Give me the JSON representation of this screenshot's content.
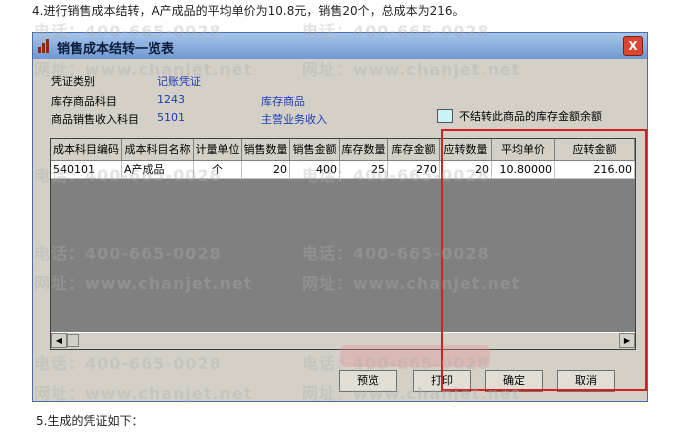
{
  "intro_text": "4.进行销售成本结转，A产成品的平均单价为10.8元，销售20个，总成本为216。",
  "outro_text": "5.生成的凭证如下：",
  "window": {
    "title": "销售成本结转一览表",
    "close_label": "X"
  },
  "fields": {
    "voucher_type_label": "凭证类别",
    "voucher_type_value": "记账凭证",
    "inventory_account_label": "库存商品科目",
    "inventory_account_code": "1243",
    "inventory_account_name": "库存商品",
    "revenue_account_label": "商品销售收入科目",
    "revenue_account_code": "5101",
    "revenue_account_name": "主营业务收入",
    "checkbox_label": "不结转此商品的库存金额余额",
    "checkbox_checked": false
  },
  "table": {
    "columns": [
      "成本科目编码",
      "成本科目名称",
      "计量单位",
      "销售数量",
      "销售金额",
      "库存数量",
      "库存金额",
      "应转数量",
      "平均单价",
      "应转金额"
    ],
    "rows": [
      [
        "540101",
        "A产成品",
        "个",
        "20",
        "400",
        "25",
        "270",
        "20",
        "10.80000",
        "216.00"
      ]
    ]
  },
  "buttons": {
    "preview": "预览",
    "print": "打印",
    "confirm": "确定",
    "cancel": "取消"
  },
  "watermarks": {
    "phone": "电话：400-665-0028",
    "site": "网址：www.chanjet.net"
  },
  "colors": {
    "titlebar": "#6f98d2",
    "link_text": "#1c3cb5",
    "highlight": "#d42020",
    "checkbox_fill": "#c9f3f6"
  }
}
